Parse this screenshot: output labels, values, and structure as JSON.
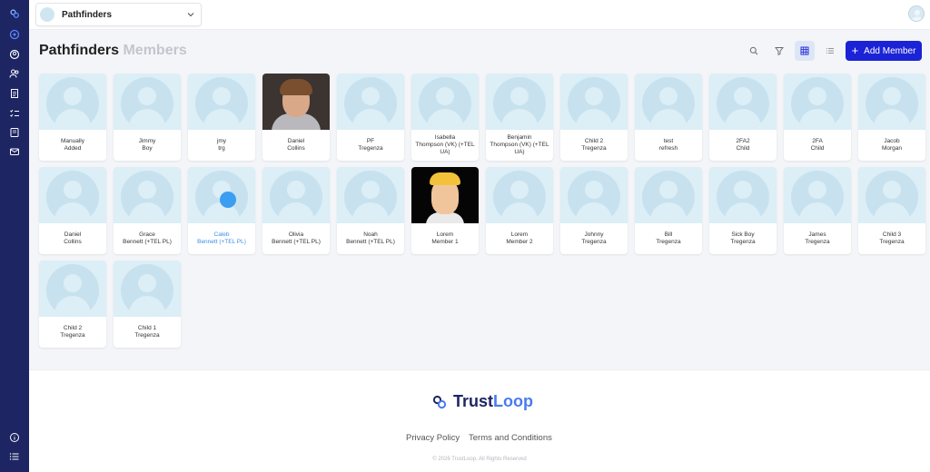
{
  "header": {
    "org_name": "Pathfinders",
    "org_chevron_icon": "chevron-down-icon",
    "user_avatar_icon": "user-avatar-icon"
  },
  "sidebar": {
    "items": [
      {
        "icon": "logo-icon"
      },
      {
        "icon": "dashboard-icon"
      },
      {
        "icon": "profile-icon"
      },
      {
        "icon": "members-icon"
      },
      {
        "icon": "document-icon"
      },
      {
        "icon": "checklist-icon"
      },
      {
        "icon": "book-icon"
      },
      {
        "icon": "mail-icon"
      },
      {
        "icon": "info-icon"
      },
      {
        "icon": "menu-icon"
      }
    ]
  },
  "page": {
    "title_strong": "Pathfinders",
    "title_muted": "Members",
    "add_button_label": "Add Member",
    "tools": [
      "search-icon",
      "filter-icon",
      "grid-view-icon",
      "list-view-icon"
    ],
    "active_view": "grid",
    "accent_color": "#1b23d6"
  },
  "members": [
    {
      "name": "Manually\nAdded",
      "photo": "none"
    },
    {
      "name": "Jimmy\nBoy",
      "photo": "none"
    },
    {
      "name": "jmy\ntrg",
      "photo": "none"
    },
    {
      "name": "Daniel\nCollins",
      "photo": "boy"
    },
    {
      "name": "PF\nTregenza",
      "photo": "none"
    },
    {
      "name": "Isabella\nThompson (VK) (+TEL\nUA)",
      "photo": "none"
    },
    {
      "name": "Benjamin\nThompson (VK) (+TEL\nUA)",
      "photo": "none"
    },
    {
      "name": "Child 2\nTregenza",
      "photo": "none"
    },
    {
      "name": "test\nrefresh",
      "photo": "none"
    },
    {
      "name": "2FA2\nChild",
      "photo": "none"
    },
    {
      "name": "2FA\nChild",
      "photo": "none"
    },
    {
      "name": "Jacob\nMorgan",
      "photo": "none"
    },
    {
      "name": "Daniel\nCollins",
      "photo": "none"
    },
    {
      "name": "Grace\nBennett (+TEL PL)",
      "photo": "none"
    },
    {
      "name": "Caleb\nBennett (+TEL PL)",
      "photo": "none",
      "selected": true
    },
    {
      "name": "Olivia\nBennett (+TEL PL)",
      "photo": "none"
    },
    {
      "name": "Noah\nBennett (+TEL PL)",
      "photo": "none"
    },
    {
      "name": "Lorem\nMember 1",
      "photo": "cartoon"
    },
    {
      "name": "Lorem\nMember 2",
      "photo": "none"
    },
    {
      "name": "Johnny\nTregenza",
      "photo": "none"
    },
    {
      "name": "Bill\nTregenza",
      "photo": "none"
    },
    {
      "name": "Sick Boy\nTregenza",
      "photo": "none"
    },
    {
      "name": "James\nTregenza",
      "photo": "none"
    },
    {
      "name": "Child 3\nTregenza",
      "photo": "none"
    },
    {
      "name": "Child 2\nTregenza",
      "photo": "none"
    },
    {
      "name": "Child 1\nTregenza",
      "photo": "none"
    }
  ],
  "footer": {
    "brand_strong": "Trust",
    "brand_accent": "Loop",
    "privacy_label": "Privacy Policy",
    "terms_label": "Terms and Conditions",
    "copyright": "© 2026 TrustLoop. All Rights Reserved"
  }
}
